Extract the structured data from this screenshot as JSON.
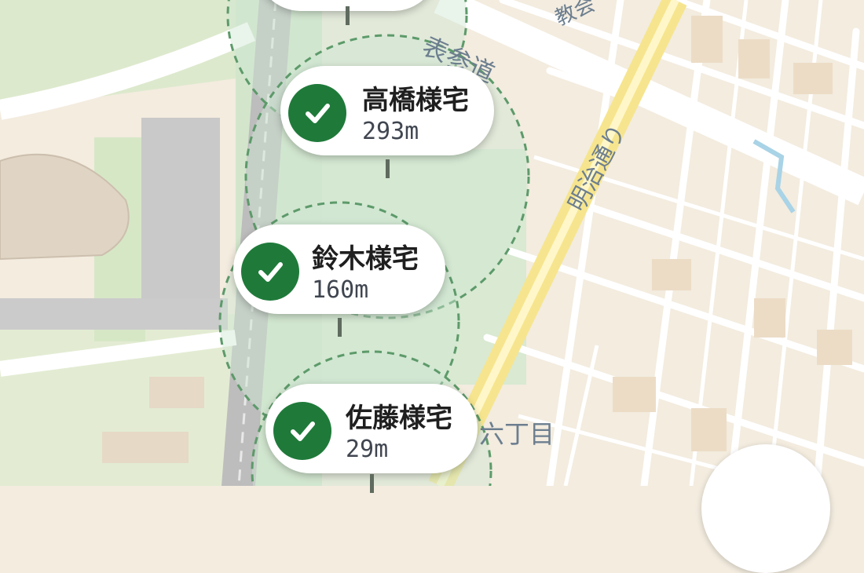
{
  "map": {
    "labels": {
      "omotesando": "表参道",
      "meiji_dori": "明治通り",
      "rokuchome": "六丁目",
      "partial_top": "教会"
    },
    "colors": {
      "land": "#f3ecdf",
      "park": "#dce9cf",
      "road": "#ffffff",
      "main_road": "#f7e9a0",
      "radius_fill": "#cfe6d2",
      "radius_stroke": "#5d9a6a",
      "check": "#1f7a3a"
    }
  },
  "markers": [
    {
      "name": "高橋様宅",
      "distance": "293m",
      "icon": "check-icon"
    },
    {
      "name": "鈴木様宅",
      "distance": "160m",
      "icon": "check-icon"
    },
    {
      "name": "佐藤様宅",
      "distance": "29m",
      "icon": "check-icon"
    }
  ]
}
